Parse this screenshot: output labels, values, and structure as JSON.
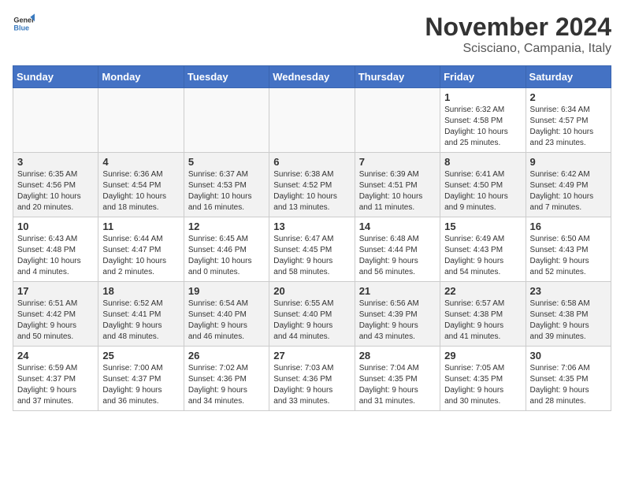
{
  "logo": {
    "line1": "General",
    "line2": "Blue"
  },
  "title": "November 2024",
  "subtitle": "Scisciano, Campania, Italy",
  "days_of_week": [
    "Sunday",
    "Monday",
    "Tuesday",
    "Wednesday",
    "Thursday",
    "Friday",
    "Saturday"
  ],
  "weeks": [
    [
      {
        "day": "",
        "info": ""
      },
      {
        "day": "",
        "info": ""
      },
      {
        "day": "",
        "info": ""
      },
      {
        "day": "",
        "info": ""
      },
      {
        "day": "",
        "info": ""
      },
      {
        "day": "1",
        "info": "Sunrise: 6:32 AM\nSunset: 4:58 PM\nDaylight: 10 hours\nand 25 minutes."
      },
      {
        "day": "2",
        "info": "Sunrise: 6:34 AM\nSunset: 4:57 PM\nDaylight: 10 hours\nand 23 minutes."
      }
    ],
    [
      {
        "day": "3",
        "info": "Sunrise: 6:35 AM\nSunset: 4:56 PM\nDaylight: 10 hours\nand 20 minutes."
      },
      {
        "day": "4",
        "info": "Sunrise: 6:36 AM\nSunset: 4:54 PM\nDaylight: 10 hours\nand 18 minutes."
      },
      {
        "day": "5",
        "info": "Sunrise: 6:37 AM\nSunset: 4:53 PM\nDaylight: 10 hours\nand 16 minutes."
      },
      {
        "day": "6",
        "info": "Sunrise: 6:38 AM\nSunset: 4:52 PM\nDaylight: 10 hours\nand 13 minutes."
      },
      {
        "day": "7",
        "info": "Sunrise: 6:39 AM\nSunset: 4:51 PM\nDaylight: 10 hours\nand 11 minutes."
      },
      {
        "day": "8",
        "info": "Sunrise: 6:41 AM\nSunset: 4:50 PM\nDaylight: 10 hours\nand 9 minutes."
      },
      {
        "day": "9",
        "info": "Sunrise: 6:42 AM\nSunset: 4:49 PM\nDaylight: 10 hours\nand 7 minutes."
      }
    ],
    [
      {
        "day": "10",
        "info": "Sunrise: 6:43 AM\nSunset: 4:48 PM\nDaylight: 10 hours\nand 4 minutes."
      },
      {
        "day": "11",
        "info": "Sunrise: 6:44 AM\nSunset: 4:47 PM\nDaylight: 10 hours\nand 2 minutes."
      },
      {
        "day": "12",
        "info": "Sunrise: 6:45 AM\nSunset: 4:46 PM\nDaylight: 10 hours\nand 0 minutes."
      },
      {
        "day": "13",
        "info": "Sunrise: 6:47 AM\nSunset: 4:45 PM\nDaylight: 9 hours\nand 58 minutes."
      },
      {
        "day": "14",
        "info": "Sunrise: 6:48 AM\nSunset: 4:44 PM\nDaylight: 9 hours\nand 56 minutes."
      },
      {
        "day": "15",
        "info": "Sunrise: 6:49 AM\nSunset: 4:43 PM\nDaylight: 9 hours\nand 54 minutes."
      },
      {
        "day": "16",
        "info": "Sunrise: 6:50 AM\nSunset: 4:43 PM\nDaylight: 9 hours\nand 52 minutes."
      }
    ],
    [
      {
        "day": "17",
        "info": "Sunrise: 6:51 AM\nSunset: 4:42 PM\nDaylight: 9 hours\nand 50 minutes."
      },
      {
        "day": "18",
        "info": "Sunrise: 6:52 AM\nSunset: 4:41 PM\nDaylight: 9 hours\nand 48 minutes."
      },
      {
        "day": "19",
        "info": "Sunrise: 6:54 AM\nSunset: 4:40 PM\nDaylight: 9 hours\nand 46 minutes."
      },
      {
        "day": "20",
        "info": "Sunrise: 6:55 AM\nSunset: 4:40 PM\nDaylight: 9 hours\nand 44 minutes."
      },
      {
        "day": "21",
        "info": "Sunrise: 6:56 AM\nSunset: 4:39 PM\nDaylight: 9 hours\nand 43 minutes."
      },
      {
        "day": "22",
        "info": "Sunrise: 6:57 AM\nSunset: 4:38 PM\nDaylight: 9 hours\nand 41 minutes."
      },
      {
        "day": "23",
        "info": "Sunrise: 6:58 AM\nSunset: 4:38 PM\nDaylight: 9 hours\nand 39 minutes."
      }
    ],
    [
      {
        "day": "24",
        "info": "Sunrise: 6:59 AM\nSunset: 4:37 PM\nDaylight: 9 hours\nand 37 minutes."
      },
      {
        "day": "25",
        "info": "Sunrise: 7:00 AM\nSunset: 4:37 PM\nDaylight: 9 hours\nand 36 minutes."
      },
      {
        "day": "26",
        "info": "Sunrise: 7:02 AM\nSunset: 4:36 PM\nDaylight: 9 hours\nand 34 minutes."
      },
      {
        "day": "27",
        "info": "Sunrise: 7:03 AM\nSunset: 4:36 PM\nDaylight: 9 hours\nand 33 minutes."
      },
      {
        "day": "28",
        "info": "Sunrise: 7:04 AM\nSunset: 4:35 PM\nDaylight: 9 hours\nand 31 minutes."
      },
      {
        "day": "29",
        "info": "Sunrise: 7:05 AM\nSunset: 4:35 PM\nDaylight: 9 hours\nand 30 minutes."
      },
      {
        "day": "30",
        "info": "Sunrise: 7:06 AM\nSunset: 4:35 PM\nDaylight: 9 hours\nand 28 minutes."
      }
    ]
  ]
}
